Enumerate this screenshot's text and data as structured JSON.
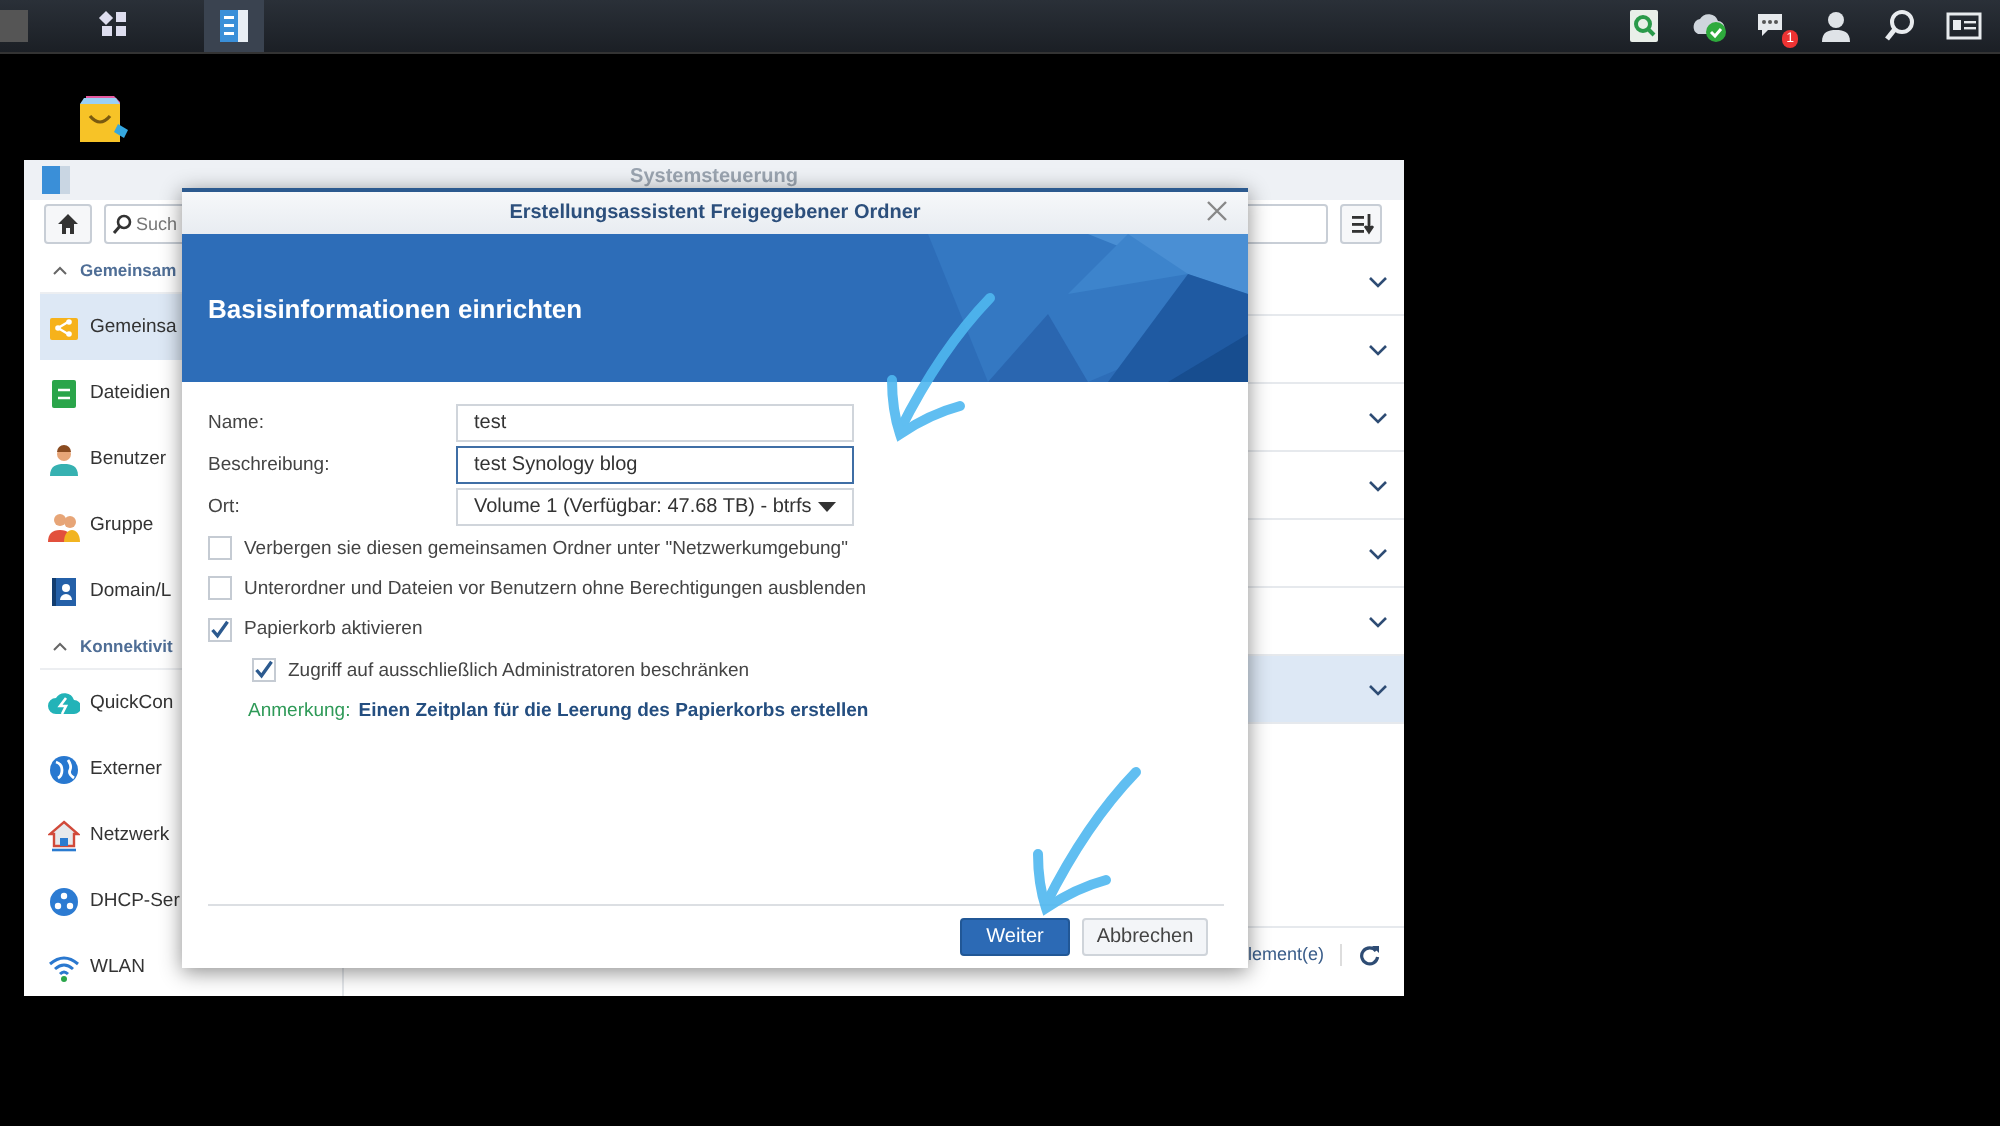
{
  "taskbar": {
    "apps": [
      {
        "kind": "main_menu",
        "selected": false
      },
      {
        "kind": "control_panel",
        "selected": true
      }
    ],
    "tray": [
      {
        "kind": "search_doc"
      },
      {
        "kind": "cloud_check"
      },
      {
        "kind": "chat",
        "badge": "1"
      },
      {
        "kind": "user"
      },
      {
        "kind": "search"
      },
      {
        "kind": "card"
      }
    ]
  },
  "desktop_icons": [
    {
      "kind": "package"
    }
  ],
  "window": {
    "title": "Systemsteuerung",
    "search": {
      "placeholder": "Such"
    },
    "sidebar": [
      {
        "label": "Gemeinsam",
        "expanded": true,
        "items": [
          {
            "label": "Gemeinsa",
            "kind": "share",
            "selected": true
          },
          {
            "label": "Dateidien",
            "kind": "file_service",
            "selected": false
          },
          {
            "label": "Benutzer",
            "kind": "user",
            "selected": false
          },
          {
            "label": "Gruppe",
            "kind": "group",
            "selected": false
          },
          {
            "label": "Domain/L",
            "kind": "domain",
            "selected": false
          }
        ]
      },
      {
        "label": "Konnektivit",
        "expanded": true,
        "items": [
          {
            "label": "QuickCon",
            "kind": "quickconnect",
            "selected": false
          },
          {
            "label": "Externer",
            "kind": "globe",
            "selected": false
          },
          {
            "label": "Netzwerk",
            "kind": "network",
            "selected": false
          },
          {
            "label": "DHCP-Ser",
            "kind": "dhcp",
            "selected": false
          },
          {
            "label": "WLAN",
            "kind": "wifi",
            "selected": false
          }
        ]
      }
    ],
    "rows": [
      {
        "selected": false
      },
      {
        "selected": false
      },
      {
        "selected": false
      },
      {
        "selected": false
      },
      {
        "selected": false
      },
      {
        "selected": false
      },
      {
        "selected": true
      }
    ],
    "status": "lement(e)"
  },
  "dialog": {
    "title": "Erstellungsassistent Freigegebener Ordner",
    "heading": "Basisinformationen einrichten",
    "fields": [
      {
        "label": "Name:",
        "kind": "text",
        "value": "test",
        "focused": false
      },
      {
        "label": "Beschreibung:",
        "kind": "text",
        "value": "test Synology blog",
        "focused": true
      },
      {
        "label": "Ort:",
        "kind": "select",
        "value": "Volume 1 (Verfügbar: 47.68 TB) - btrfs",
        "focused": false
      }
    ],
    "options": [
      {
        "label": "Verbergen sie diesen gemeinsamen Ordner unter \"Netzwerkumgebung\"",
        "checked": false
      },
      {
        "label": "Unterordner und Dateien vor Benutzern ohne Berechtigungen ausblenden",
        "checked": false
      },
      {
        "label": "Papierkorb aktivieren",
        "checked": true,
        "children": [
          {
            "label": "Zugriff auf ausschließlich Administratoren beschränken",
            "checked": true
          }
        ]
      }
    ],
    "note": {
      "label": "Anmerkung:",
      "link": "Einen Zeitplan für die Leerung des Papierkorbs erstellen"
    },
    "buttons": [
      {
        "label": "Weiter",
        "kind": "primary"
      },
      {
        "label": "Abbrechen",
        "kind": "secondary"
      }
    ]
  },
  "annotations": [
    {
      "kind": "arrow"
    },
    {
      "kind": "arrow"
    }
  ]
}
